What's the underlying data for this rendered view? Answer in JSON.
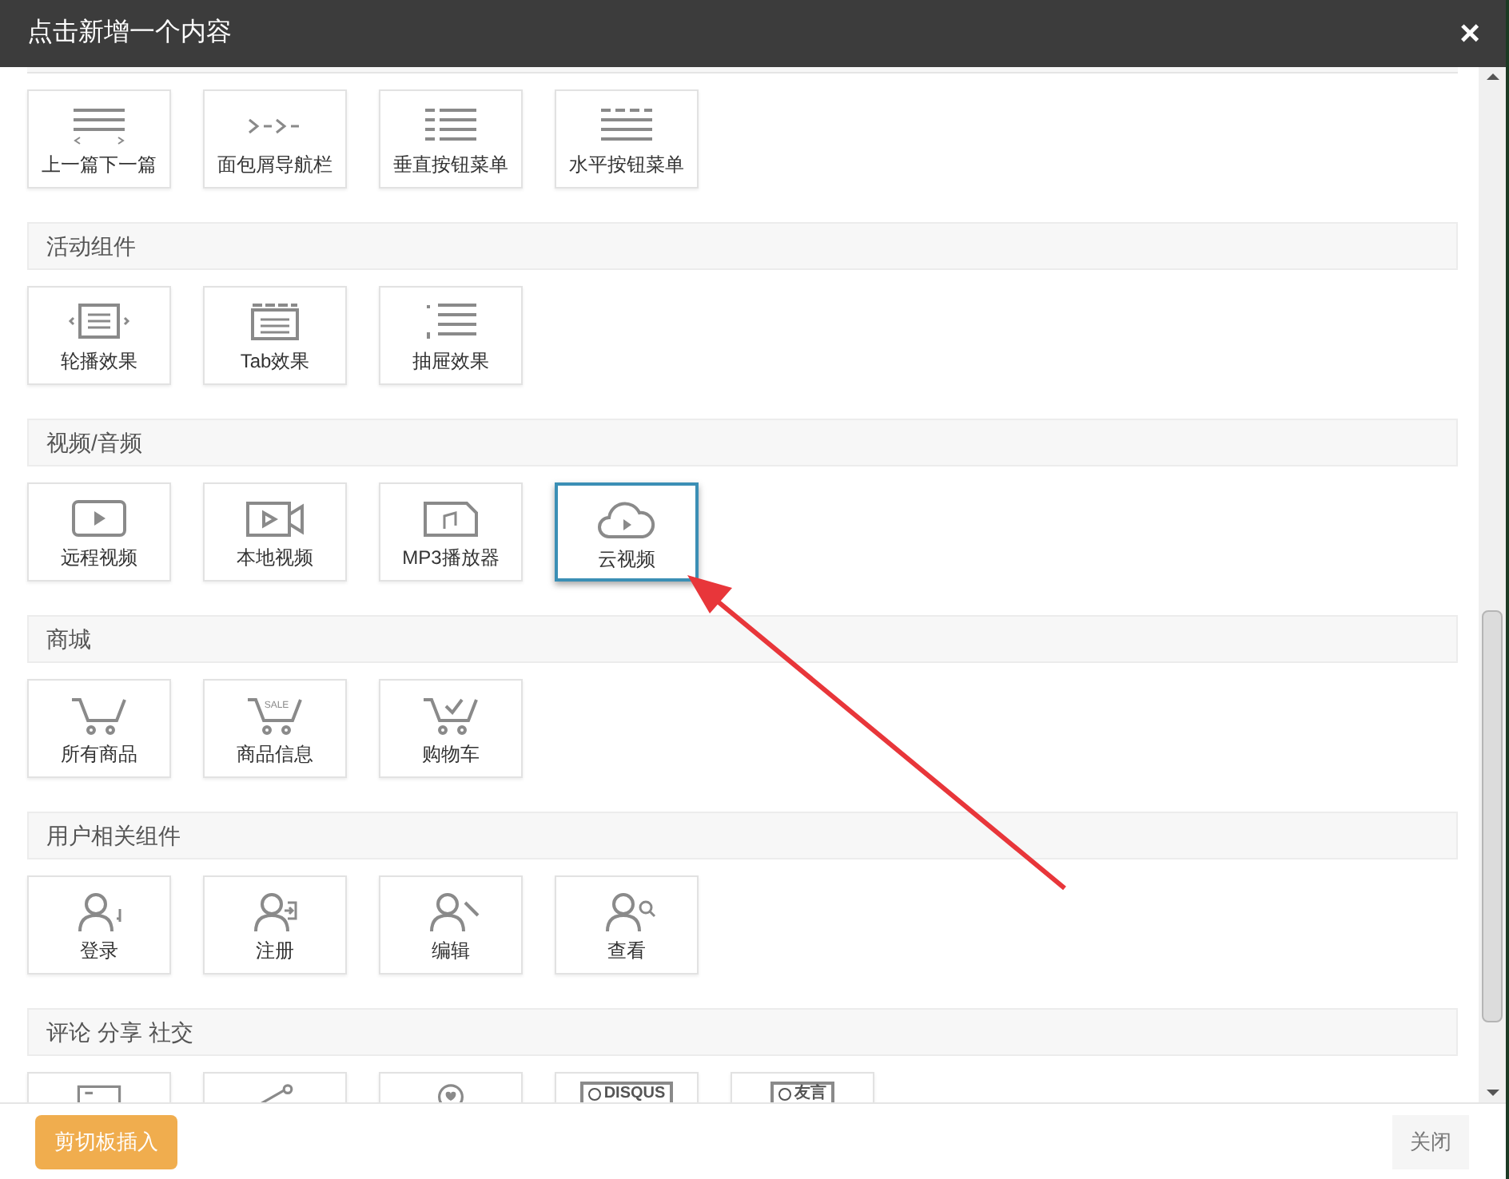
{
  "window": {
    "title": "点击新增一个内容",
    "close": "×"
  },
  "top_row": [
    {
      "label": "上一篇下一篇",
      "kind": "prev-next",
      "selected": false
    },
    {
      "label": "面包屑导航栏",
      "kind": "breadcrumb",
      "selected": false
    },
    {
      "label": "垂直按钮菜单",
      "kind": "vertical-menu",
      "selected": false
    },
    {
      "label": "水平按钮菜单",
      "kind": "horizontal-menu",
      "selected": false
    }
  ],
  "sections": [
    {
      "title": "活动组件",
      "items": [
        {
          "label": "轮播效果",
          "kind": "carousel",
          "selected": false
        },
        {
          "label": "Tab效果",
          "kind": "tab",
          "selected": false
        },
        {
          "label": "抽屉效果",
          "kind": "accordion",
          "selected": false
        }
      ]
    },
    {
      "title": "视频/音频",
      "items": [
        {
          "label": "远程视频",
          "kind": "screen-play",
          "selected": false
        },
        {
          "label": "本地视频",
          "kind": "camera",
          "selected": false
        },
        {
          "label": "MP3播放器",
          "kind": "music-file",
          "selected": false
        },
        {
          "label": "云视频",
          "kind": "cloud-play",
          "selected": true
        }
      ]
    },
    {
      "title": "商城",
      "items": [
        {
          "label": "所有商品",
          "kind": "cart",
          "selected": false
        },
        {
          "label": "商品信息",
          "kind": "cart-sale",
          "icon_text": "SALE",
          "selected": false
        },
        {
          "label": "购物车",
          "kind": "cart-check",
          "selected": false
        }
      ]
    },
    {
      "title": "用户相关组件",
      "items": [
        {
          "label": "登录",
          "kind": "user-key",
          "selected": false
        },
        {
          "label": "注册",
          "kind": "user-enter",
          "selected": false
        },
        {
          "label": "编辑",
          "kind": "user-pen",
          "selected": false
        },
        {
          "label": "查看",
          "kind": "user-search",
          "selected": false
        }
      ]
    },
    {
      "title": "评论 分享 社交",
      "items": [
        {
          "kind": "comment-box",
          "selected": false
        },
        {
          "kind": "share",
          "selected": false
        },
        {
          "kind": "heart-circle",
          "selected": false
        },
        {
          "kind": "badge-logo",
          "icon_text": "DISQUS",
          "selected": false
        },
        {
          "kind": "badge-logo",
          "icon_text": "友言",
          "selected": false
        }
      ]
    }
  ],
  "footer": {
    "paste_button": "剪切板插入",
    "close_button": "关闭"
  }
}
